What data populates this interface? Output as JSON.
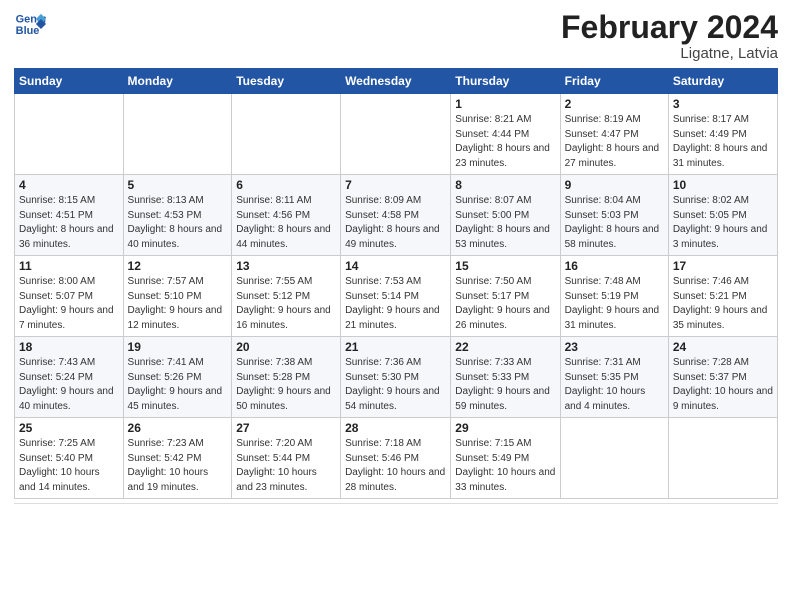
{
  "header": {
    "logo_line1": "General",
    "logo_line2": "Blue",
    "title": "February 2024",
    "subtitle": "Ligatne, Latvia"
  },
  "weekdays": [
    "Sunday",
    "Monday",
    "Tuesday",
    "Wednesday",
    "Thursday",
    "Friday",
    "Saturday"
  ],
  "weeks": [
    [
      {
        "day": "",
        "sunrise": "",
        "sunset": "",
        "daylight": ""
      },
      {
        "day": "",
        "sunrise": "",
        "sunset": "",
        "daylight": ""
      },
      {
        "day": "",
        "sunrise": "",
        "sunset": "",
        "daylight": ""
      },
      {
        "day": "",
        "sunrise": "",
        "sunset": "",
        "daylight": ""
      },
      {
        "day": "1",
        "sunrise": "Sunrise: 8:21 AM",
        "sunset": "Sunset: 4:44 PM",
        "daylight": "Daylight: 8 hours and 23 minutes."
      },
      {
        "day": "2",
        "sunrise": "Sunrise: 8:19 AM",
        "sunset": "Sunset: 4:47 PM",
        "daylight": "Daylight: 8 hours and 27 minutes."
      },
      {
        "day": "3",
        "sunrise": "Sunrise: 8:17 AM",
        "sunset": "Sunset: 4:49 PM",
        "daylight": "Daylight: 8 hours and 31 minutes."
      }
    ],
    [
      {
        "day": "4",
        "sunrise": "Sunrise: 8:15 AM",
        "sunset": "Sunset: 4:51 PM",
        "daylight": "Daylight: 8 hours and 36 minutes."
      },
      {
        "day": "5",
        "sunrise": "Sunrise: 8:13 AM",
        "sunset": "Sunset: 4:53 PM",
        "daylight": "Daylight: 8 hours and 40 minutes."
      },
      {
        "day": "6",
        "sunrise": "Sunrise: 8:11 AM",
        "sunset": "Sunset: 4:56 PM",
        "daylight": "Daylight: 8 hours and 44 minutes."
      },
      {
        "day": "7",
        "sunrise": "Sunrise: 8:09 AM",
        "sunset": "Sunset: 4:58 PM",
        "daylight": "Daylight: 8 hours and 49 minutes."
      },
      {
        "day": "8",
        "sunrise": "Sunrise: 8:07 AM",
        "sunset": "Sunset: 5:00 PM",
        "daylight": "Daylight: 8 hours and 53 minutes."
      },
      {
        "day": "9",
        "sunrise": "Sunrise: 8:04 AM",
        "sunset": "Sunset: 5:03 PM",
        "daylight": "Daylight: 8 hours and 58 minutes."
      },
      {
        "day": "10",
        "sunrise": "Sunrise: 8:02 AM",
        "sunset": "Sunset: 5:05 PM",
        "daylight": "Daylight: 9 hours and 3 minutes."
      }
    ],
    [
      {
        "day": "11",
        "sunrise": "Sunrise: 8:00 AM",
        "sunset": "Sunset: 5:07 PM",
        "daylight": "Daylight: 9 hours and 7 minutes."
      },
      {
        "day": "12",
        "sunrise": "Sunrise: 7:57 AM",
        "sunset": "Sunset: 5:10 PM",
        "daylight": "Daylight: 9 hours and 12 minutes."
      },
      {
        "day": "13",
        "sunrise": "Sunrise: 7:55 AM",
        "sunset": "Sunset: 5:12 PM",
        "daylight": "Daylight: 9 hours and 16 minutes."
      },
      {
        "day": "14",
        "sunrise": "Sunrise: 7:53 AM",
        "sunset": "Sunset: 5:14 PM",
        "daylight": "Daylight: 9 hours and 21 minutes."
      },
      {
        "day": "15",
        "sunrise": "Sunrise: 7:50 AM",
        "sunset": "Sunset: 5:17 PM",
        "daylight": "Daylight: 9 hours and 26 minutes."
      },
      {
        "day": "16",
        "sunrise": "Sunrise: 7:48 AM",
        "sunset": "Sunset: 5:19 PM",
        "daylight": "Daylight: 9 hours and 31 minutes."
      },
      {
        "day": "17",
        "sunrise": "Sunrise: 7:46 AM",
        "sunset": "Sunset: 5:21 PM",
        "daylight": "Daylight: 9 hours and 35 minutes."
      }
    ],
    [
      {
        "day": "18",
        "sunrise": "Sunrise: 7:43 AM",
        "sunset": "Sunset: 5:24 PM",
        "daylight": "Daylight: 9 hours and 40 minutes."
      },
      {
        "day": "19",
        "sunrise": "Sunrise: 7:41 AM",
        "sunset": "Sunset: 5:26 PM",
        "daylight": "Daylight: 9 hours and 45 minutes."
      },
      {
        "day": "20",
        "sunrise": "Sunrise: 7:38 AM",
        "sunset": "Sunset: 5:28 PM",
        "daylight": "Daylight: 9 hours and 50 minutes."
      },
      {
        "day": "21",
        "sunrise": "Sunrise: 7:36 AM",
        "sunset": "Sunset: 5:30 PM",
        "daylight": "Daylight: 9 hours and 54 minutes."
      },
      {
        "day": "22",
        "sunrise": "Sunrise: 7:33 AM",
        "sunset": "Sunset: 5:33 PM",
        "daylight": "Daylight: 9 hours and 59 minutes."
      },
      {
        "day": "23",
        "sunrise": "Sunrise: 7:31 AM",
        "sunset": "Sunset: 5:35 PM",
        "daylight": "Daylight: 10 hours and 4 minutes."
      },
      {
        "day": "24",
        "sunrise": "Sunrise: 7:28 AM",
        "sunset": "Sunset: 5:37 PM",
        "daylight": "Daylight: 10 hours and 9 minutes."
      }
    ],
    [
      {
        "day": "25",
        "sunrise": "Sunrise: 7:25 AM",
        "sunset": "Sunset: 5:40 PM",
        "daylight": "Daylight: 10 hours and 14 minutes."
      },
      {
        "day": "26",
        "sunrise": "Sunrise: 7:23 AM",
        "sunset": "Sunset: 5:42 PM",
        "daylight": "Daylight: 10 hours and 19 minutes."
      },
      {
        "day": "27",
        "sunrise": "Sunrise: 7:20 AM",
        "sunset": "Sunset: 5:44 PM",
        "daylight": "Daylight: 10 hours and 23 minutes."
      },
      {
        "day": "28",
        "sunrise": "Sunrise: 7:18 AM",
        "sunset": "Sunset: 5:46 PM",
        "daylight": "Daylight: 10 hours and 28 minutes."
      },
      {
        "day": "29",
        "sunrise": "Sunrise: 7:15 AM",
        "sunset": "Sunset: 5:49 PM",
        "daylight": "Daylight: 10 hours and 33 minutes."
      },
      {
        "day": "",
        "sunrise": "",
        "sunset": "",
        "daylight": ""
      },
      {
        "day": "",
        "sunrise": "",
        "sunset": "",
        "daylight": ""
      }
    ]
  ]
}
